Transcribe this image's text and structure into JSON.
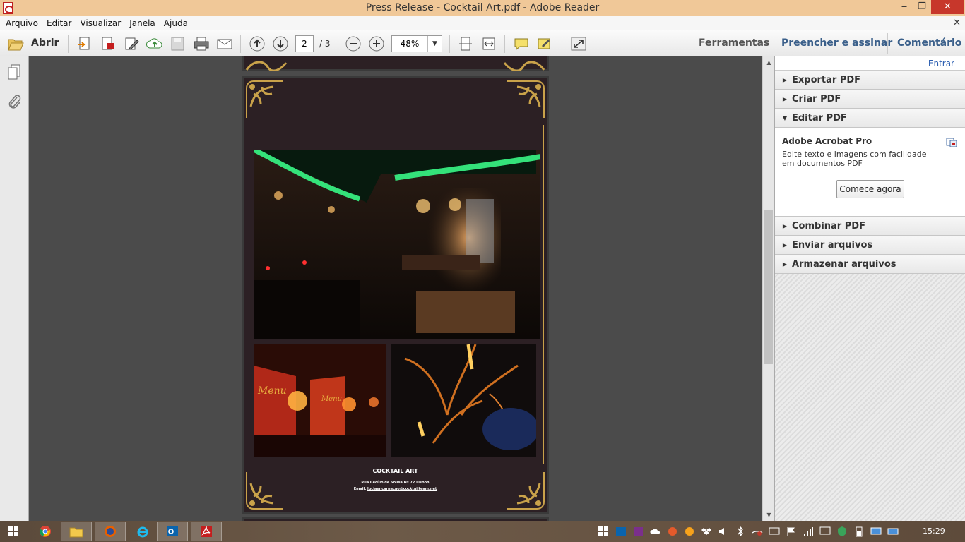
{
  "window": {
    "title": "Press Release - Cocktail Art.pdf - Adobe Reader",
    "minimize": "‒",
    "maximize": "❐",
    "close": "✕"
  },
  "menu": {
    "items": [
      "Arquivo",
      "Editar",
      "Visualizar",
      "Janela",
      "Ajuda"
    ],
    "close": "✕"
  },
  "toolbar": {
    "open_label": "Abrir",
    "page_current": "2",
    "page_total": "/ 3",
    "zoom": "48%",
    "zoom_dropdown": "▼",
    "tools": "Ferramentas",
    "fill_sign": "Preencher e assinar",
    "comment": "Comentário"
  },
  "document": {
    "venue": "COCKTAIL ART",
    "address": "Rua Cecílio de Sousa Nº 72 Lisbon",
    "email_label": "Email:",
    "email": "luciaencarnacao@cocktailteam.net"
  },
  "right_panel": {
    "signin": "Entrar",
    "sections": {
      "export": "Exportar PDF",
      "create": "Criar PDF",
      "edit": "Editar PDF",
      "combine": "Combinar PDF",
      "send": "Enviar arquivos",
      "store": "Armazenar arquivos"
    },
    "edit_body": {
      "heading": "Adobe Acrobat Pro",
      "description": "Edite texto e imagens com facilidade em documentos PDF",
      "button": "Comece agora"
    }
  },
  "taskbar": {
    "clock": "15:29"
  },
  "colors": {
    "titlebar": "#f0c898",
    "link": "#3a5f8a",
    "close": "#c7372b",
    "page_bg": "#2c2024",
    "gold": "#c9a24a"
  }
}
